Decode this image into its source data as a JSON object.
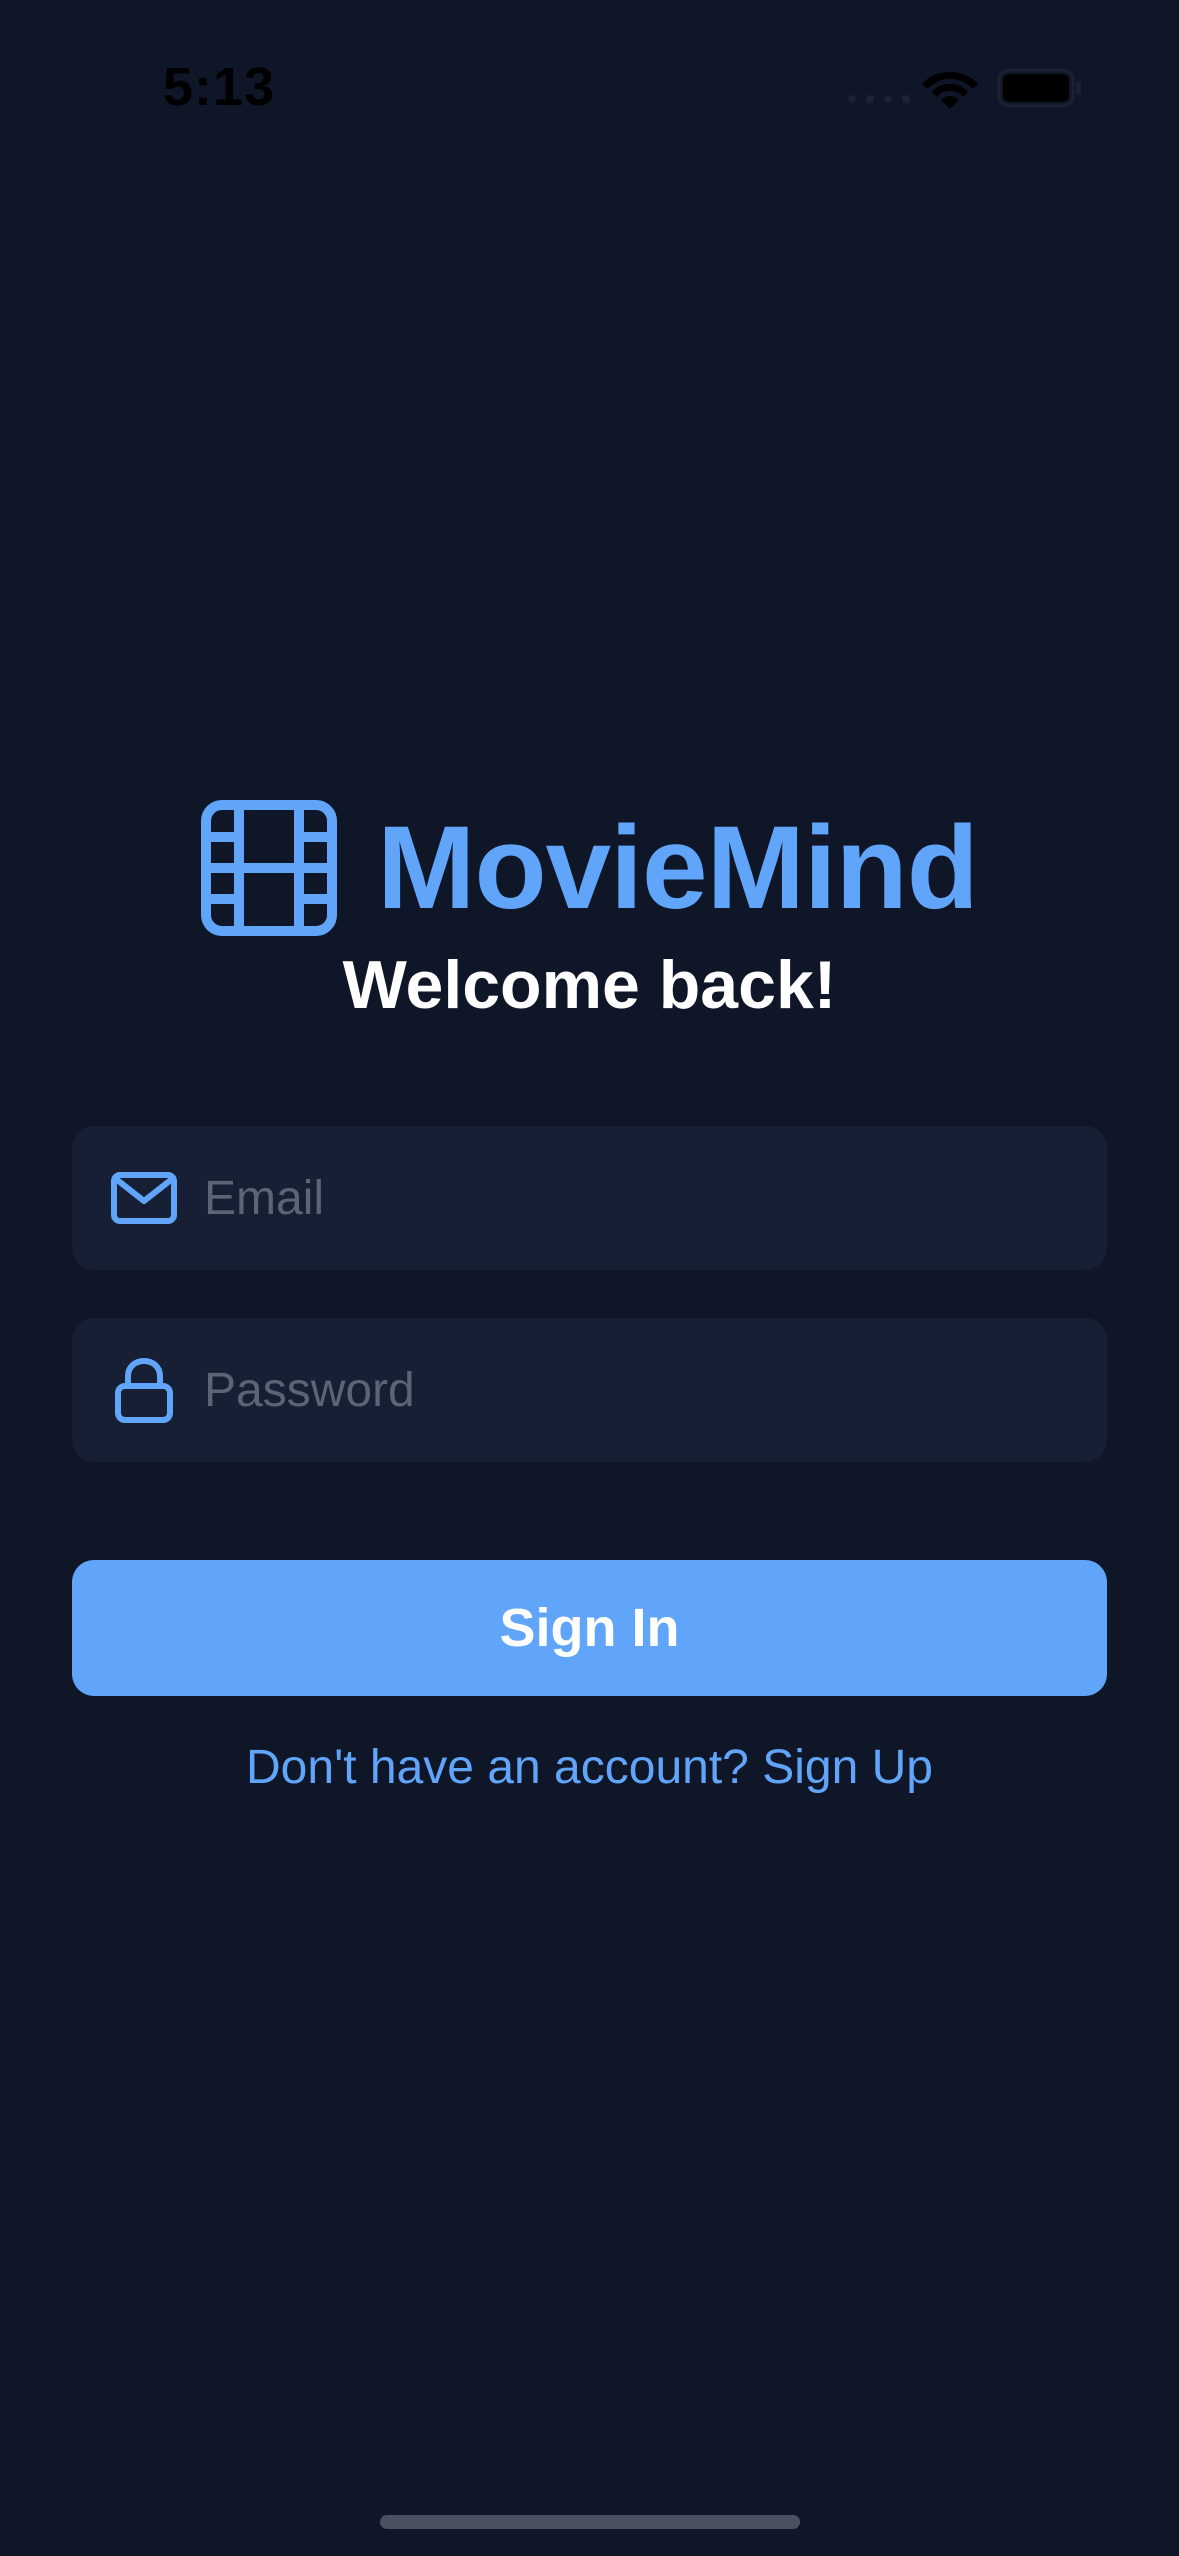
{
  "status_bar": {
    "time": "5:13",
    "icons": [
      "wifi-icon",
      "battery-icon"
    ]
  },
  "brand": {
    "name": "MovieMind",
    "icon": "film-icon"
  },
  "welcome": "Welcome back!",
  "form": {
    "email": {
      "placeholder": "Email",
      "value": "",
      "icon": "mail-icon"
    },
    "password": {
      "placeholder": "Password",
      "value": "",
      "icon": "lock-icon"
    },
    "submit_label": "Sign In",
    "signup_link": "Don't have an account? Sign Up"
  },
  "colors": {
    "background": "#0f1628",
    "field_background": "#161f33",
    "accent": "#60a5fa",
    "text": "#ffffff",
    "placeholder": "#5b6576"
  }
}
